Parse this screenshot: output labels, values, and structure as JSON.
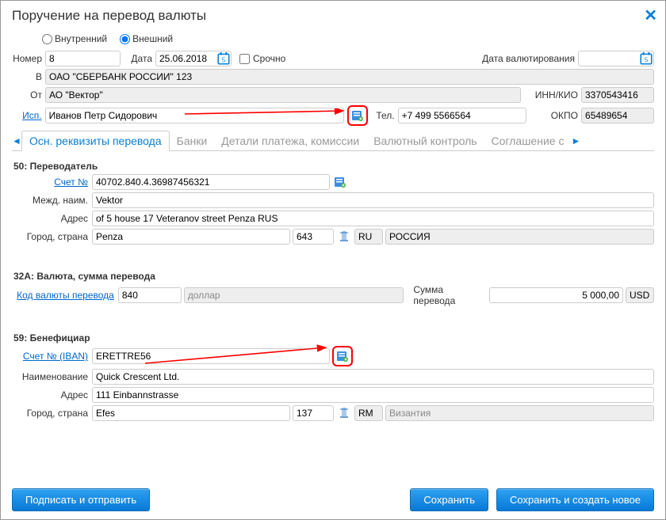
{
  "window": {
    "title": "Поручение на перевод валюты"
  },
  "radios": {
    "internal": "Внутренний",
    "external": "Внешний",
    "selected": "external"
  },
  "header": {
    "number_label": "Номер",
    "number": "8",
    "date_label": "Дата",
    "date": "25.06.2018",
    "urgent_label": "Срочно",
    "value_date_label": "Дата валютирования",
    "value_date": "",
    "to_label": "В",
    "to": "ОАО \"СБЕРБАНК РОССИИ\" 123",
    "from_label": "От",
    "from": "АО \"Вектор\"",
    "inn_label": "ИНН/КИО",
    "inn": "3370543416",
    "isp_label": "Исп.",
    "isp": "Иванов Петр Сидорович",
    "tel_label": "Тел.",
    "tel": "+7 499 5566564",
    "okpo_label": "ОКПО",
    "okpo": "65489654"
  },
  "tabs": {
    "items": [
      "Осн. реквизиты перевода",
      "Банки",
      "Детали платежа, комиссии",
      "Валютный контроль",
      "Соглашение с"
    ],
    "active_index": 0
  },
  "sec50": {
    "title": "50: Переводатель",
    "account_label": "Счет №",
    "account": "40702.840.4.36987456321",
    "intl_name_label": "Межд. наим.",
    "intl_name": "Vektor",
    "addr_label": "Адрес",
    "addr": "of 5 house 17 Veteranov street Penza RUS",
    "city_label": "Город, страна",
    "city": "Penza",
    "country_code": "643",
    "country_short": "RU",
    "country_name": "РОССИЯ"
  },
  "sec32a": {
    "title": "32A: Валюта, сумма перевода",
    "curr_label": "Код валюты перевода",
    "curr_code": "840",
    "curr_name": "доллар",
    "sum_label": "Сумма перевода",
    "sum": "5 000,00",
    "usd": "USD"
  },
  "sec59": {
    "title": "59: Бенефициар",
    "account_label": "Счет № (IBAN)",
    "account": "ERETTRE56",
    "name_label": "Наименование",
    "name": "Quick Crescent Ltd.",
    "addr_label": "Адрес",
    "addr": "111 Einbannstrasse",
    "city_label": "Город, страна",
    "city": "Efes",
    "country_code": "137",
    "country_short": "RM",
    "country_name": "Византия"
  },
  "buttons": {
    "sign_send": "Подписать и отправить",
    "save": "Сохранить",
    "save_new": "Сохранить и создать новое"
  }
}
